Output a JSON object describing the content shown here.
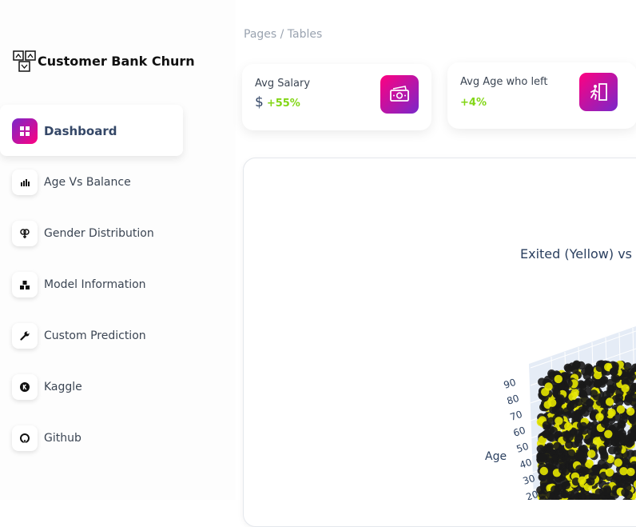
{
  "brand": {
    "name": "Customer Bank Churn"
  },
  "sidebar": {
    "items": [
      {
        "label": "Dashboard",
        "icon": "dashboard-icon",
        "active": true
      },
      {
        "label": "Age Vs Balance",
        "icon": "bar-chart-icon"
      },
      {
        "label": "Gender Distribution",
        "icon": "gender-icon"
      },
      {
        "label": "Model Information",
        "icon": "cubes-icon"
      },
      {
        "label": "Custom Prediction",
        "icon": "wrench-icon"
      },
      {
        "label": "Kaggle",
        "icon": "kaggle-icon"
      },
      {
        "label": "Github",
        "icon": "github-icon"
      }
    ]
  },
  "breadcrumb": "Pages / Tables",
  "stats": [
    {
      "label": "Avg Salary",
      "currency": "$",
      "change": "+55%",
      "icon": "money-icon"
    },
    {
      "label": "Avg Age who left",
      "change": "+4%",
      "icon": "exit-icon"
    }
  ],
  "chart": {
    "title": "Exited (Yellow) vs",
    "axis_label": "Age",
    "ticks": [
      "90",
      "80",
      "70",
      "60",
      "50",
      "40",
      "30",
      "20"
    ],
    "colors": {
      "exited": "#e6e600",
      "stayed": "#1a1a1a",
      "accent": "#82d616"
    }
  },
  "chart_data": {
    "type": "scatter",
    "title": "Exited (Yellow) vs",
    "zlabel": "Age",
    "zlim": [
      20,
      90
    ],
    "series": [
      {
        "name": "Yellow"
      }
    ]
  }
}
